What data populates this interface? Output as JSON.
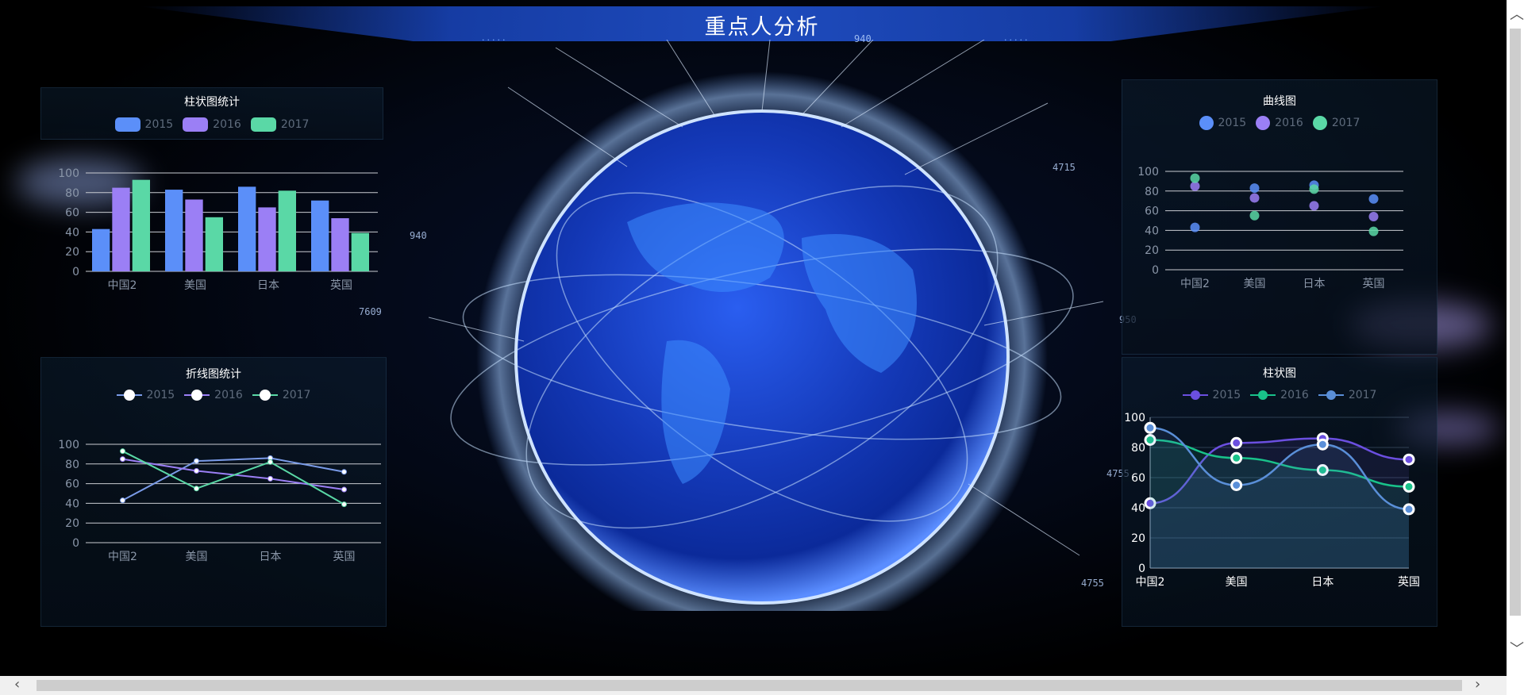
{
  "header": {
    "title": "重点人分析",
    "dots_left": ".....",
    "dots_right": "....."
  },
  "globe": {
    "labels": [
      "940",
      "4715",
      "7609",
      "950",
      "4755",
      "940",
      "4755"
    ]
  },
  "colors": {
    "c2015": "#5b8ff9",
    "c2016": "#9b7ff5",
    "c2017": "#5ad8a6",
    "p2015": "#6b4fe0",
    "p2016": "#19c28a",
    "p2017": "#5a8fd8"
  },
  "legend_years": [
    "2015",
    "2016",
    "2017"
  ],
  "chart_data": [
    {
      "id": "bar",
      "type": "bar",
      "title": "柱状图统计",
      "categories": [
        "中国2",
        "美国",
        "日本",
        "英国"
      ],
      "series": [
        {
          "name": "2015",
          "values": [
            43,
            83,
            86,
            72
          ]
        },
        {
          "name": "2016",
          "values": [
            85,
            73,
            65,
            54
          ]
        },
        {
          "name": "2017",
          "values": [
            93,
            55,
            82,
            39
          ]
        }
      ],
      "ylim": [
        0,
        100
      ],
      "yticks": [
        0,
        20,
        40,
        60,
        80,
        100
      ],
      "grid": true,
      "legend": "top"
    },
    {
      "id": "line",
      "type": "line",
      "title": "折线图统计",
      "categories": [
        "中国2",
        "美国",
        "日本",
        "英国"
      ],
      "series": [
        {
          "name": "2015",
          "values": [
            43,
            83,
            86,
            72
          ]
        },
        {
          "name": "2016",
          "values": [
            85,
            73,
            65,
            54
          ]
        },
        {
          "name": "2017",
          "values": [
            93,
            55,
            82,
            39
          ]
        }
      ],
      "ylim": [
        0,
        100
      ],
      "yticks": [
        0,
        20,
        40,
        60,
        80,
        100
      ],
      "grid": true,
      "legend": "top"
    },
    {
      "id": "scatter",
      "type": "scatter",
      "title": "曲线图",
      "categories": [
        "中国2",
        "美国",
        "日本",
        "英国"
      ],
      "series": [
        {
          "name": "2015",
          "values": [
            43,
            83,
            86,
            72
          ]
        },
        {
          "name": "2016",
          "values": [
            85,
            73,
            65,
            54
          ]
        },
        {
          "name": "2017",
          "values": [
            93,
            55,
            82,
            39
          ]
        }
      ],
      "ylim": [
        0,
        100
      ],
      "yticks": [
        0,
        20,
        40,
        60,
        80,
        100
      ],
      "grid": true,
      "legend": "top"
    },
    {
      "id": "area",
      "type": "area",
      "title": "柱状图",
      "categories": [
        "中国2",
        "美国",
        "日本",
        "英国"
      ],
      "series": [
        {
          "name": "2015",
          "values": [
            43,
            83,
            86,
            72
          ]
        },
        {
          "name": "2016",
          "values": [
            85,
            73,
            65,
            54
          ]
        },
        {
          "name": "2017",
          "values": [
            93,
            55,
            82,
            39
          ]
        }
      ],
      "ylim": [
        0,
        100
      ],
      "yticks": [
        0,
        20,
        40,
        60,
        80,
        100
      ],
      "grid": true,
      "legend": "top"
    }
  ]
}
